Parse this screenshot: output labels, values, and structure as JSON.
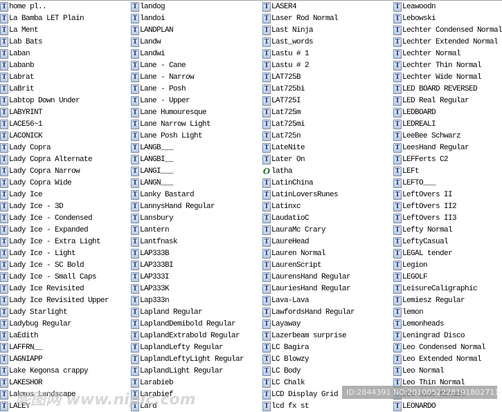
{
  "columns": [
    {
      "items": [
        {
          "name": "home pl..",
          "icon": "truetype-font-icon"
        },
        {
          "name": "La Bamba LET Plain",
          "icon": "truetype-font-icon"
        },
        {
          "name": "La Ment",
          "icon": "truetype-font-icon"
        },
        {
          "name": "Lab Bats",
          "icon": "truetype-font-icon"
        },
        {
          "name": "Laban",
          "icon": "truetype-font-icon"
        },
        {
          "name": "Labanb",
          "icon": "truetype-font-icon"
        },
        {
          "name": "Labrat",
          "icon": "truetype-font-icon"
        },
        {
          "name": "LaBrit",
          "icon": "truetype-font-icon"
        },
        {
          "name": "Labtop Down Under",
          "icon": "truetype-font-icon"
        },
        {
          "name": "LABYRINT",
          "icon": "truetype-font-icon"
        },
        {
          "name": "LACE56~1",
          "icon": "truetype-font-icon"
        },
        {
          "name": "LACONICK",
          "icon": "truetype-font-icon"
        },
        {
          "name": "Lady Copra",
          "icon": "truetype-font-icon"
        },
        {
          "name": "Lady Copra Alternate",
          "icon": "truetype-font-icon"
        },
        {
          "name": "Lady Copra Narrow",
          "icon": "truetype-font-icon"
        },
        {
          "name": "Lady Copra Wide",
          "icon": "truetype-font-icon"
        },
        {
          "name": "Lady Ice",
          "icon": "truetype-font-icon"
        },
        {
          "name": "Lady Ice - 3D",
          "icon": "truetype-font-icon"
        },
        {
          "name": "Lady Ice - Condensed",
          "icon": "truetype-font-icon"
        },
        {
          "name": "Lady Ice - Expanded",
          "icon": "truetype-font-icon"
        },
        {
          "name": "Lady Ice - Extra Light",
          "icon": "truetype-font-icon"
        },
        {
          "name": "Lady Ice - Light",
          "icon": "truetype-font-icon"
        },
        {
          "name": "Lady Ice - SC Bold",
          "icon": "truetype-font-icon"
        },
        {
          "name": "Lady Ice - Small Caps",
          "icon": "truetype-font-icon"
        },
        {
          "name": "Lady Ice Revisited",
          "icon": "truetype-font-icon"
        },
        {
          "name": "Lady Ice Revisited Upper",
          "icon": "truetype-font-icon"
        },
        {
          "name": "Lady Starlight",
          "icon": "truetype-font-icon"
        },
        {
          "name": "Ladybug Regular",
          "icon": "truetype-font-icon"
        },
        {
          "name": "LaEdith",
          "icon": "truetype-font-icon"
        },
        {
          "name": "LAFFRN__",
          "icon": "truetype-font-icon"
        },
        {
          "name": "LAGNIAPP",
          "icon": "truetype-font-icon"
        },
        {
          "name": "Lake Kegonsa crappy",
          "icon": "truetype-font-icon"
        },
        {
          "name": "LAKESHOR",
          "icon": "truetype-font-icon"
        },
        {
          "name": "Lakmus Landscape",
          "icon": "truetype-font-icon"
        },
        {
          "name": "LALEY",
          "icon": "truetype-font-icon"
        }
      ]
    },
    {
      "items": [
        {
          "name": "landog",
          "icon": "truetype-font-icon"
        },
        {
          "name": "landoi",
          "icon": "truetype-font-icon"
        },
        {
          "name": "LANDPLAN",
          "icon": "truetype-font-icon"
        },
        {
          "name": "Landw",
          "icon": "truetype-font-icon"
        },
        {
          "name": "Landwi",
          "icon": "truetype-font-icon"
        },
        {
          "name": "Lane - Cane",
          "icon": "truetype-font-icon"
        },
        {
          "name": "Lane - Narrow",
          "icon": "truetype-font-icon"
        },
        {
          "name": "Lane - Posh",
          "icon": "truetype-font-icon"
        },
        {
          "name": "Lane - Upper",
          "icon": "truetype-font-icon"
        },
        {
          "name": "Lane Humouresque",
          "icon": "truetype-font-icon"
        },
        {
          "name": "Lane Narrow Light",
          "icon": "truetype-font-icon"
        },
        {
          "name": "Lane Posh Light",
          "icon": "truetype-font-icon"
        },
        {
          "name": "LANGB___",
          "icon": "truetype-font-icon"
        },
        {
          "name": "LANGBI__",
          "icon": "truetype-font-icon"
        },
        {
          "name": "LANGI___",
          "icon": "truetype-font-icon"
        },
        {
          "name": "LANGN___",
          "icon": "truetype-font-icon"
        },
        {
          "name": "Lanky Bastard",
          "icon": "truetype-font-icon"
        },
        {
          "name": "LannysHand Regular",
          "icon": "truetype-font-icon"
        },
        {
          "name": "Lansbury",
          "icon": "truetype-font-icon"
        },
        {
          "name": "Lantern",
          "icon": "truetype-font-icon"
        },
        {
          "name": "Lantfnask",
          "icon": "truetype-font-icon"
        },
        {
          "name": "LAP333B",
          "icon": "truetype-font-icon"
        },
        {
          "name": "LAP333BI",
          "icon": "truetype-font-icon"
        },
        {
          "name": "LAP333I",
          "icon": "truetype-font-icon"
        },
        {
          "name": "LAP333K",
          "icon": "truetype-font-icon"
        },
        {
          "name": "Lap333n",
          "icon": "truetype-font-icon"
        },
        {
          "name": "Lapland Regular",
          "icon": "truetype-font-icon"
        },
        {
          "name": "LaplandDemibold Regular",
          "icon": "truetype-font-icon"
        },
        {
          "name": "LaplandExtrabold Regular",
          "icon": "truetype-font-icon"
        },
        {
          "name": "LaplandLefty Regular",
          "icon": "truetype-font-icon"
        },
        {
          "name": "LaplandLeftyLight Regular",
          "icon": "truetype-font-icon"
        },
        {
          "name": "LaplandLight Regular",
          "icon": "truetype-font-icon"
        },
        {
          "name": "Larabieb",
          "icon": "truetype-font-icon"
        },
        {
          "name": "Larabief",
          "icon": "truetype-font-icon"
        },
        {
          "name": "Lard",
          "icon": "truetype-font-icon"
        }
      ]
    },
    {
      "items": [
        {
          "name": "LASER4",
          "icon": "truetype-font-icon"
        },
        {
          "name": "Laser Rod Normal",
          "icon": "truetype-font-icon"
        },
        {
          "name": "Last Ninja",
          "icon": "truetype-font-icon"
        },
        {
          "name": "Last_words",
          "icon": "truetype-font-icon"
        },
        {
          "name": "Lastu # 1",
          "icon": "truetype-font-icon"
        },
        {
          "name": "Lastu # 2",
          "icon": "truetype-font-icon"
        },
        {
          "name": "LAT725B",
          "icon": "truetype-font-icon"
        },
        {
          "name": "Lat725bi",
          "icon": "truetype-font-icon"
        },
        {
          "name": "LAT725I",
          "icon": "truetype-font-icon"
        },
        {
          "name": "Lat725m",
          "icon": "truetype-font-icon"
        },
        {
          "name": "Lat725mi",
          "icon": "truetype-font-icon"
        },
        {
          "name": "Lat725n",
          "icon": "truetype-font-icon"
        },
        {
          "name": "LateNite",
          "icon": "truetype-font-icon"
        },
        {
          "name": "Later On",
          "icon": "truetype-font-icon"
        },
        {
          "name": "latha",
          "icon": "opentype-font-icon"
        },
        {
          "name": "LatinChina",
          "icon": "truetype-font-icon"
        },
        {
          "name": "LatinLoversRunes",
          "icon": "truetype-font-icon"
        },
        {
          "name": "Latinxc",
          "icon": "truetype-font-icon"
        },
        {
          "name": "LaudatioC",
          "icon": "truetype-font-icon"
        },
        {
          "name": "LauraMc Crary",
          "icon": "truetype-font-icon"
        },
        {
          "name": "LaureHead",
          "icon": "truetype-font-icon"
        },
        {
          "name": "Lauren Normal",
          "icon": "truetype-font-icon"
        },
        {
          "name": "LaurenScript",
          "icon": "truetype-font-icon"
        },
        {
          "name": "LaurensHand Regular",
          "icon": "truetype-font-icon"
        },
        {
          "name": "LauriesHand Regular",
          "icon": "truetype-font-icon"
        },
        {
          "name": "Lava-Lava",
          "icon": "truetype-font-icon"
        },
        {
          "name": "LawfordsHand Regular",
          "icon": "truetype-font-icon"
        },
        {
          "name": "Layaway",
          "icon": "truetype-font-icon"
        },
        {
          "name": "Lazerbeam surprise",
          "icon": "truetype-font-icon"
        },
        {
          "name": "LC Bagira",
          "icon": "truetype-font-icon"
        },
        {
          "name": "LC Blowzy",
          "icon": "truetype-font-icon"
        },
        {
          "name": "LC Body",
          "icon": "truetype-font-icon"
        },
        {
          "name": "LC Chalk",
          "icon": "truetype-font-icon"
        },
        {
          "name": "LCD Display Grid",
          "icon": "truetype-font-icon"
        },
        {
          "name": "lcd fx st",
          "icon": "truetype-font-icon"
        }
      ]
    },
    {
      "items": [
        {
          "name": "Leawoodn",
          "icon": "truetype-font-icon"
        },
        {
          "name": "Lebowski",
          "icon": "truetype-font-icon"
        },
        {
          "name": "Lechter Condensed Normal",
          "icon": "truetype-font-icon"
        },
        {
          "name": "Lechter Extended Normal",
          "icon": "truetype-font-icon"
        },
        {
          "name": "Lechter Normal",
          "icon": "truetype-font-icon"
        },
        {
          "name": "Lechter Thin Normal",
          "icon": "truetype-font-icon"
        },
        {
          "name": "Lechter Wide Normal",
          "icon": "truetype-font-icon"
        },
        {
          "name": "LED BOARD REVERSED",
          "icon": "truetype-font-icon"
        },
        {
          "name": "LED Real Regular",
          "icon": "truetype-font-icon"
        },
        {
          "name": "LEDBOARD",
          "icon": "truetype-font-icon"
        },
        {
          "name": "LEDREALI",
          "icon": "truetype-font-icon"
        },
        {
          "name": "LeeBee Schwarz",
          "icon": "truetype-font-icon"
        },
        {
          "name": "LeesHand Regular",
          "icon": "truetype-font-icon"
        },
        {
          "name": "LEFFerts C2",
          "icon": "truetype-font-icon"
        },
        {
          "name": "LEFt",
          "icon": "truetype-font-icon"
        },
        {
          "name": "LEFTO___",
          "icon": "truetype-font-icon"
        },
        {
          "name": "LeftOvers II",
          "icon": "truetype-font-icon"
        },
        {
          "name": "LeftOvers II2",
          "icon": "truetype-font-icon"
        },
        {
          "name": "LeftOvers II3",
          "icon": "truetype-font-icon"
        },
        {
          "name": "Lefty Normal",
          "icon": "truetype-font-icon"
        },
        {
          "name": "LeftyCasual",
          "icon": "truetype-font-icon"
        },
        {
          "name": "LEGAL tender",
          "icon": "truetype-font-icon"
        },
        {
          "name": "Legion",
          "icon": "truetype-font-icon"
        },
        {
          "name": "LEGOLF",
          "icon": "truetype-font-icon"
        },
        {
          "name": "LeisureCaligraphic",
          "icon": "truetype-font-icon"
        },
        {
          "name": "Lemiesz Regular",
          "icon": "truetype-font-icon"
        },
        {
          "name": "lemon",
          "icon": "truetype-font-icon"
        },
        {
          "name": "Lemonheads",
          "icon": "truetype-font-icon"
        },
        {
          "name": "Leningrad Disco",
          "icon": "truetype-font-icon"
        },
        {
          "name": "Leo Condensed Normal",
          "icon": "truetype-font-icon"
        },
        {
          "name": "Leo Extended Normal",
          "icon": "truetype-font-icon"
        },
        {
          "name": "Leo Normal",
          "icon": "truetype-font-icon"
        },
        {
          "name": "Leo Thin Normal",
          "icon": "truetype-font-icon"
        },
        {
          "name": "Leo Wide Normal",
          "icon": "truetype-font-icon"
        },
        {
          "name": "LEONARDO",
          "icon": "truetype-font-icon"
        }
      ]
    }
  ],
  "watermarks": {
    "site": "昵图网 www.nipic.com",
    "id_stamp": "ID:2844391 NO:20100522281918027114"
  }
}
